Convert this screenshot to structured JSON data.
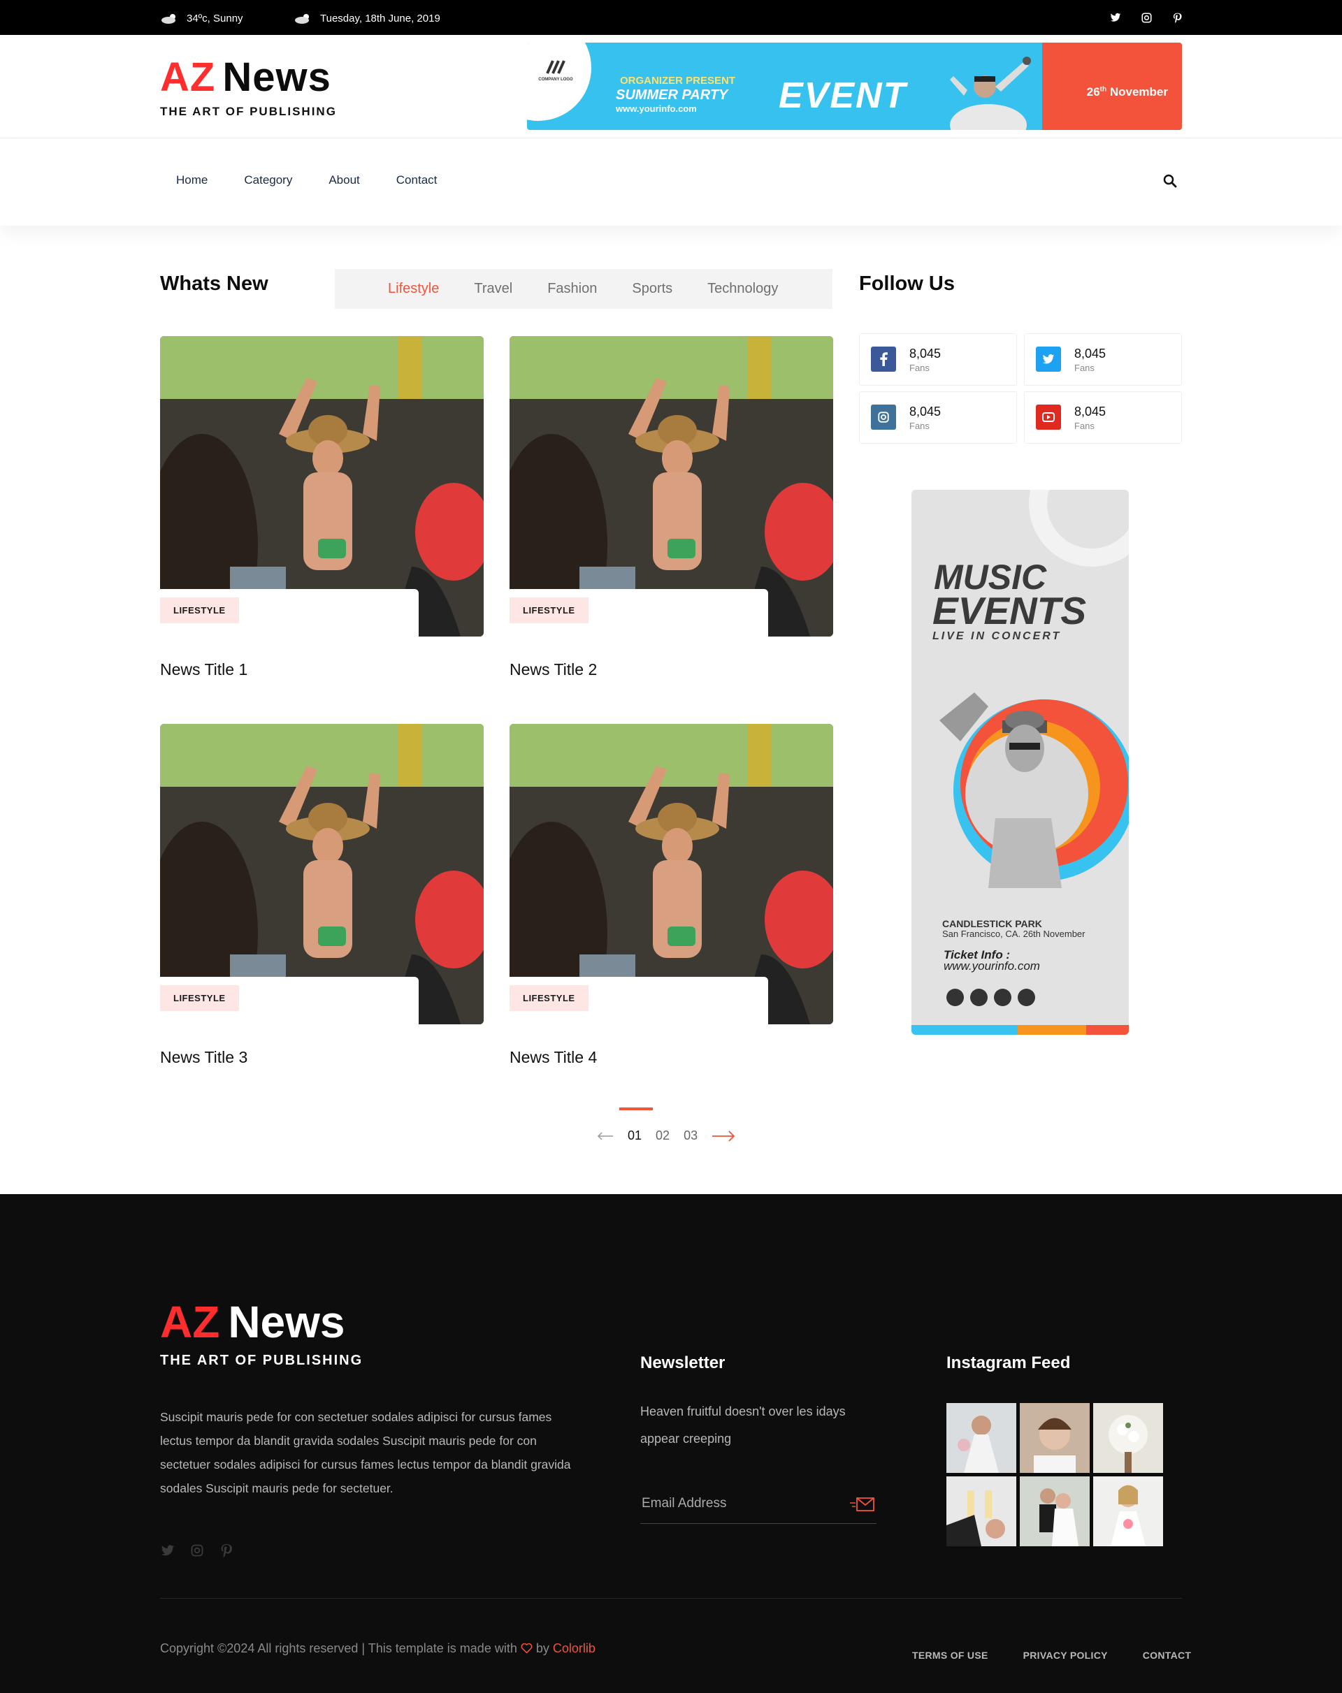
{
  "topbar": {
    "weather": "34ºc, Sunny",
    "date": "Tuesday, 18th June, 2019",
    "social_icons": [
      "twitter-icon",
      "instagram-icon",
      "pinterest-icon"
    ]
  },
  "logo": {
    "az": "AZ",
    "news": "News",
    "tagline": "THE ART OF PUBLISHING"
  },
  "banner": {
    "company_logo": "COMPANY LOGO",
    "organizer": "ORGANIZER PRESENT",
    "summer_party": "SUMMER PARTY",
    "url": "www.yourinfo.com",
    "event": "EVENT",
    "date_day": "26",
    "date_suffix": "th",
    "date_month": " November"
  },
  "nav": {
    "items": [
      "Home",
      "Category",
      "About",
      "Contact"
    ]
  },
  "whats_new": {
    "heading": "Whats New",
    "tabs": [
      "Lifestyle",
      "Travel",
      "Fashion",
      "Sports",
      "Technology"
    ],
    "active_tab": "Lifestyle"
  },
  "cards": [
    {
      "badge": "LIFESTYLE",
      "title": "News Title 1"
    },
    {
      "badge": "LIFESTYLE",
      "title": "News Title 2"
    },
    {
      "badge": "LIFESTYLE",
      "title": "News Title 3"
    },
    {
      "badge": "LIFESTYLE",
      "title": "News Title 4"
    }
  ],
  "follow": {
    "heading": "Follow Us",
    "networks": [
      {
        "icon": "facebook-icon",
        "count": "8,045",
        "label": "Fans",
        "color": "#3b5998"
      },
      {
        "icon": "twitter-icon",
        "count": "8,045",
        "label": "Fans",
        "color": "#1da1f2"
      },
      {
        "icon": "instagram-icon",
        "count": "8,045",
        "label": "Fans",
        "color": "#3f729b"
      },
      {
        "icon": "youtube-icon",
        "count": "8,045",
        "label": "Fans",
        "color": "#e02a20"
      }
    ]
  },
  "music_ad": {
    "music": "MUSIC",
    "events": "EVENTS",
    "live": "LIVE IN CONCERT",
    "park": "CANDLESTICK PARK",
    "address": "San Francisco, CA. 26th November",
    "ticket_label": "Ticket Info :",
    "ticket_url": "www.yourinfo.com"
  },
  "pagination": {
    "pages": [
      "01",
      "02",
      "03"
    ],
    "current": "01"
  },
  "footer": {
    "description": "Suscipit mauris pede for con sectetuer sodales adipisci for cursus fames lectus tempor da blandit gravida sodales Suscipit mauris pede for con sectetuer sodales adipisci for cursus fames lectus tempor da blandit gravida sodales Suscipit mauris pede for sectetuer.",
    "social_icons": [
      "twitter-icon",
      "instagram-icon",
      "pinterest-icon"
    ],
    "newsletter_heading": "Newsletter",
    "newsletter_text": "Heaven fruitful doesn't over les idays appear creeping",
    "email_placeholder": "Email Address",
    "instagram_heading": "Instagram Feed",
    "copyright_prefix": "Copyright ©2024 All rights reserved | This template is made with ",
    "copyright_by": " by ",
    "copyright_author": "Colorlib",
    "links": [
      "TERMS OF USE",
      "PRIVACY POLICY",
      "CONTACT"
    ]
  },
  "colors": {
    "accent": "#f2533a",
    "brand_red": "#ff2e2e",
    "footer_bg": "#0d0d0d"
  }
}
